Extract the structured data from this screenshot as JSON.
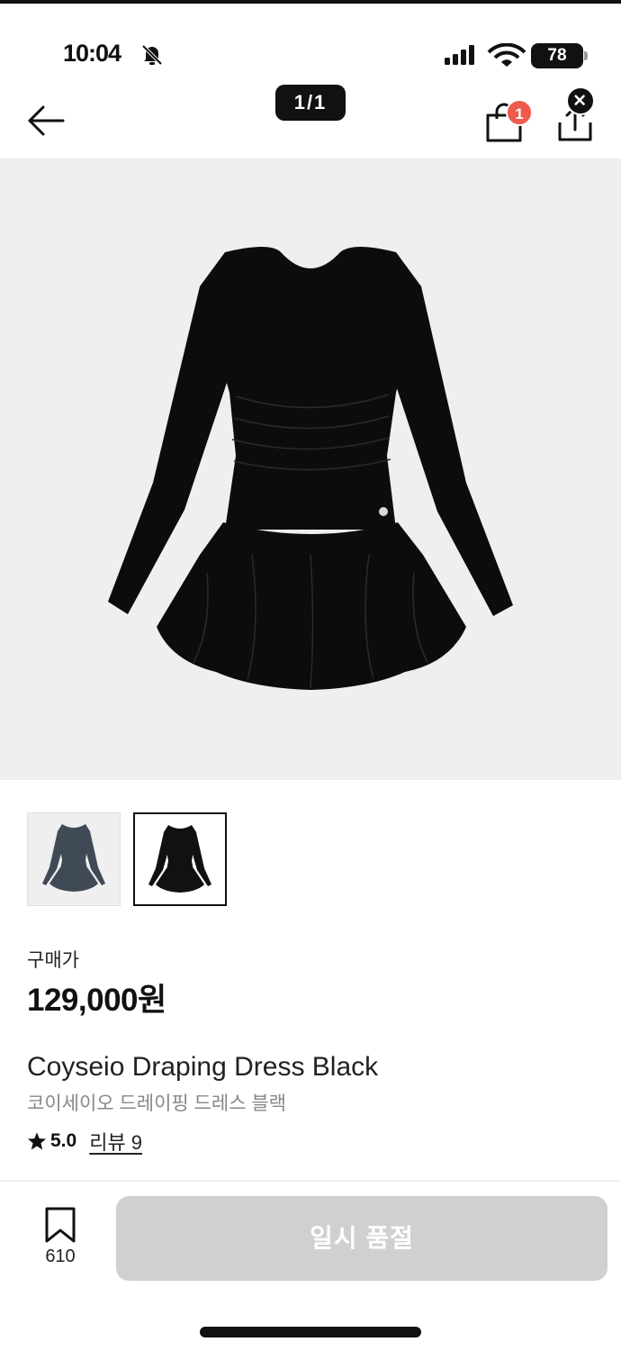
{
  "status_bar": {
    "time": "10:04",
    "battery": "78",
    "icons": [
      "bell-off-icon",
      "signal-icon",
      "wifi-icon",
      "battery-icon"
    ]
  },
  "nav": {
    "page_counter": "1/1",
    "cart_count": "1",
    "icons": [
      "back-arrow-icon",
      "shopping-bag-icon",
      "share-icon",
      "close-icon"
    ]
  },
  "product": {
    "price_label": "구매가",
    "price": "129,000원",
    "name_en": "Coyseio Draping Dress Black",
    "name_ko": "코이세이오 드레이핑 드레스 블랙",
    "rating": "5.0",
    "review_link": "리뷰 9",
    "thumbnails": [
      {
        "color": "#3f4a56",
        "selected": false
      },
      {
        "color": "#111111",
        "selected": true
      }
    ],
    "image_color": "#0c0c0c"
  },
  "footer": {
    "bookmark_count": "610",
    "soldout_label": "일시 품절"
  },
  "colors": {
    "badge": "#ef5a4c",
    "disabled_button": "#d0d0d0",
    "image_bg": "#efefef"
  }
}
